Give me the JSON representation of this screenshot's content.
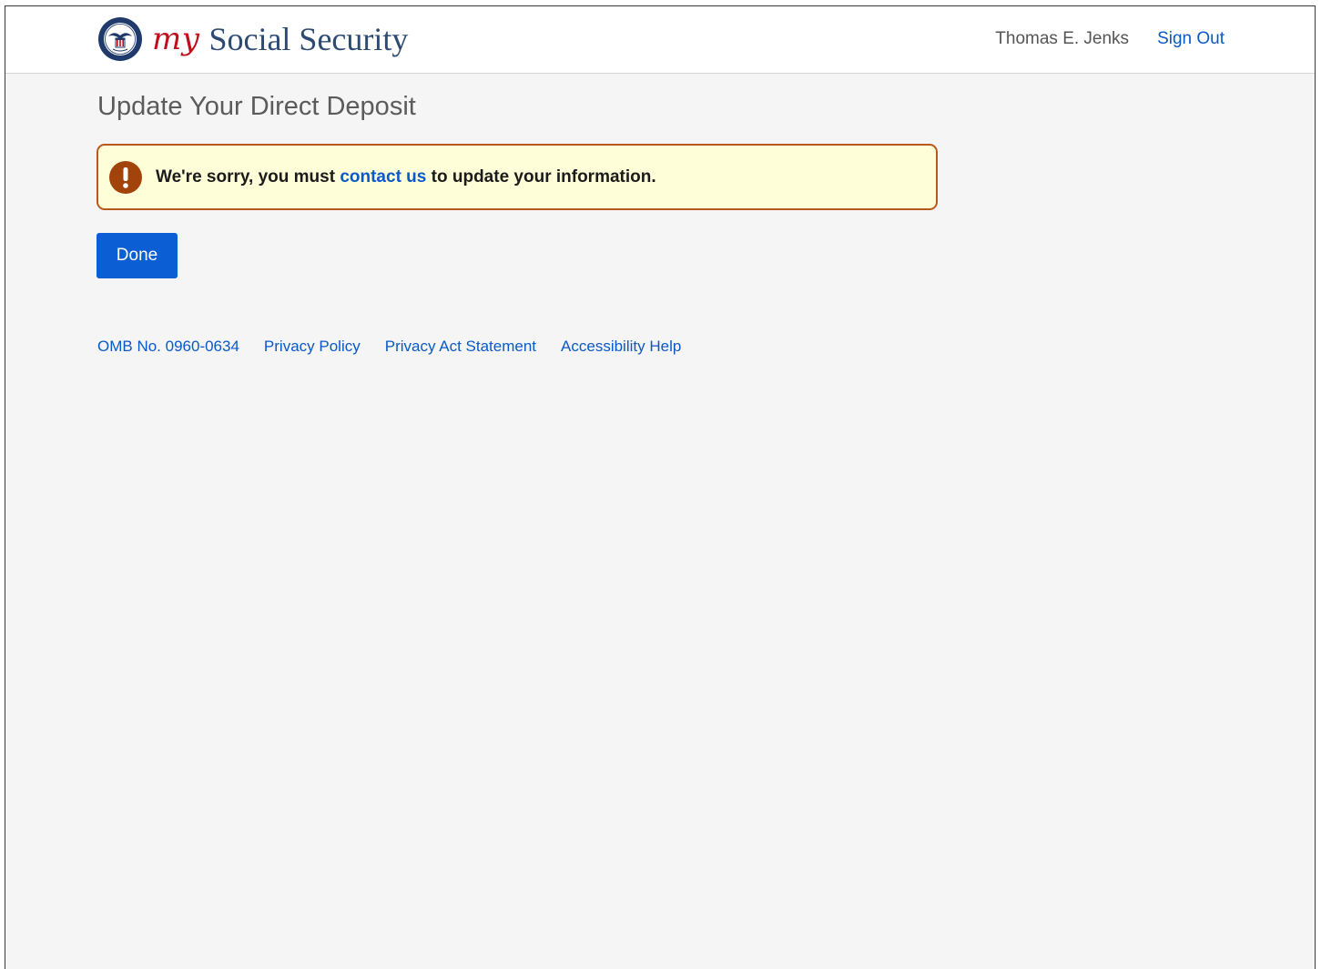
{
  "header": {
    "brand_my": "my",
    "brand_name": "Social Security",
    "user_name": "Thomas E. Jenks",
    "sign_out": "Sign Out"
  },
  "main": {
    "title": "Update Your Direct Deposit",
    "alert": {
      "icon": "exclamation-circle-icon",
      "text_before": "We're sorry, you must",
      "link_text": "contact us",
      "text_after": "to update your information."
    },
    "done_label": "Done"
  },
  "footer": {
    "links": [
      "OMB No. 0960-0634",
      "Privacy Policy",
      "Privacy Act Statement",
      "Accessibility Help"
    ]
  },
  "colors": {
    "brand_red": "#c00f1b",
    "brand_navy": "#2d4a72",
    "link_blue": "#0a59c8",
    "button_blue": "#0b5ed3",
    "alert_bg": "#fefed8",
    "alert_border": "#b8581c",
    "alert_icon": "#a1430a",
    "page_bg": "#f5f5f5"
  }
}
